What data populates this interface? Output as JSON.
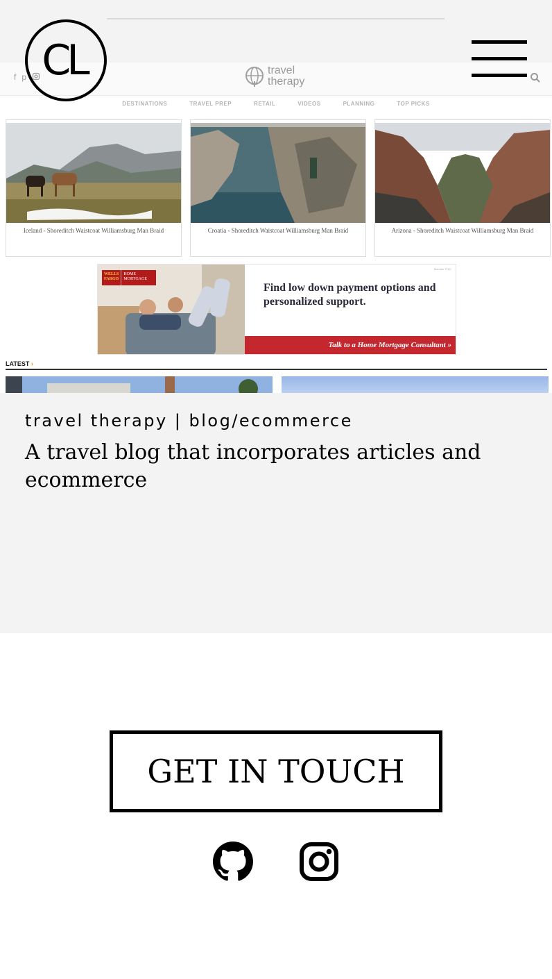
{
  "header": {
    "logo_text": "CL",
    "menu_icon": "hamburger-menu-icon"
  },
  "preview": {
    "site_name": "travel\ntherapy",
    "social_icons": [
      "facebook-icon",
      "pinterest-icon",
      "instagram-icon"
    ],
    "search_icon": "search-icon",
    "nav": [
      "DESTINATIONS",
      "TRAVEL PREP",
      "RETAIL",
      "VIDEOS",
      "PLANNING",
      "TOP PICKS"
    ],
    "cards": [
      {
        "caption": "Iceland - Shoreditch Waistcoat Williamsburg Man Braid"
      },
      {
        "caption": "Croatia - Shoreditch Waistcoat Williamsburg Man Braid"
      },
      {
        "caption": "Arizona - Shoreditch Waistcoat Williamsburg Man Braid"
      }
    ],
    "ad": {
      "brand_top": "WELLS FARGO",
      "brand_side": "HOME MORTGAGE",
      "member": "Member FDIC",
      "headline": "Find low down payment options and personalized support.",
      "cta": "Talk to a Home Mortgage Consultant »"
    },
    "latest_label": "LATEST",
    "latest_arrow": "›"
  },
  "project": {
    "title": "travel therapy | blog/ecommerce",
    "description": "A travel blog that incorporates articles and ecommerce"
  },
  "contact": {
    "button_label": "GET IN TOUCH"
  },
  "links": {
    "github_icon": "github-icon",
    "instagram_icon": "instagram-icon"
  },
  "colors": {
    "panel_bg": "#f3f3f3",
    "ad_red": "#c4282e",
    "accent_orange": "#e2a400"
  }
}
